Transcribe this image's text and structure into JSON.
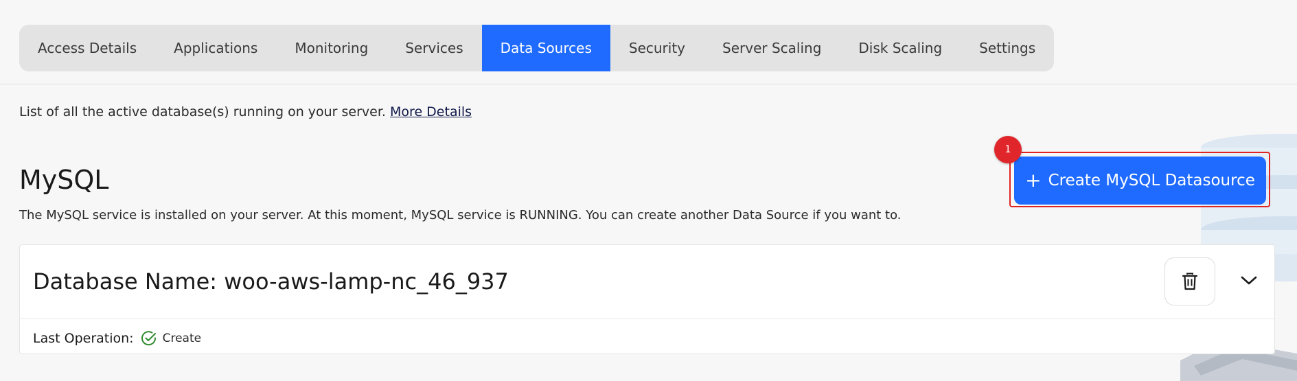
{
  "tabs": [
    {
      "label": "Access Details",
      "active": false
    },
    {
      "label": "Applications",
      "active": false
    },
    {
      "label": "Monitoring",
      "active": false
    },
    {
      "label": "Services",
      "active": false
    },
    {
      "label": "Data Sources",
      "active": true
    },
    {
      "label": "Security",
      "active": false
    },
    {
      "label": "Server Scaling",
      "active": false
    },
    {
      "label": "Disk Scaling",
      "active": false
    },
    {
      "label": "Settings",
      "active": false
    }
  ],
  "intro": {
    "text": "List of all the active database(s) running on your server.",
    "link_label": "More Details"
  },
  "section": {
    "title": "MySQL",
    "description": "The MySQL service is installed on your server. At this moment, MySQL service is RUNNING. You can create another Data Source if you want to."
  },
  "create_button": {
    "icon": "plus-icon",
    "label": "Create MySQL Datasource",
    "step_badge": "1"
  },
  "database": {
    "name": "Database Name: woo-aws-lamp-nc_46_937",
    "last_operation_label": "Last Operation:",
    "last_operation_value": "Create",
    "status_icon": "check-circle-icon",
    "delete_icon": "trash-icon",
    "expand_icon": "chevron-down-icon"
  },
  "colors": {
    "accent": "#1f6bff",
    "highlight": "#e02424",
    "success": "#2e8b2e",
    "background": "#f7f7f7"
  }
}
